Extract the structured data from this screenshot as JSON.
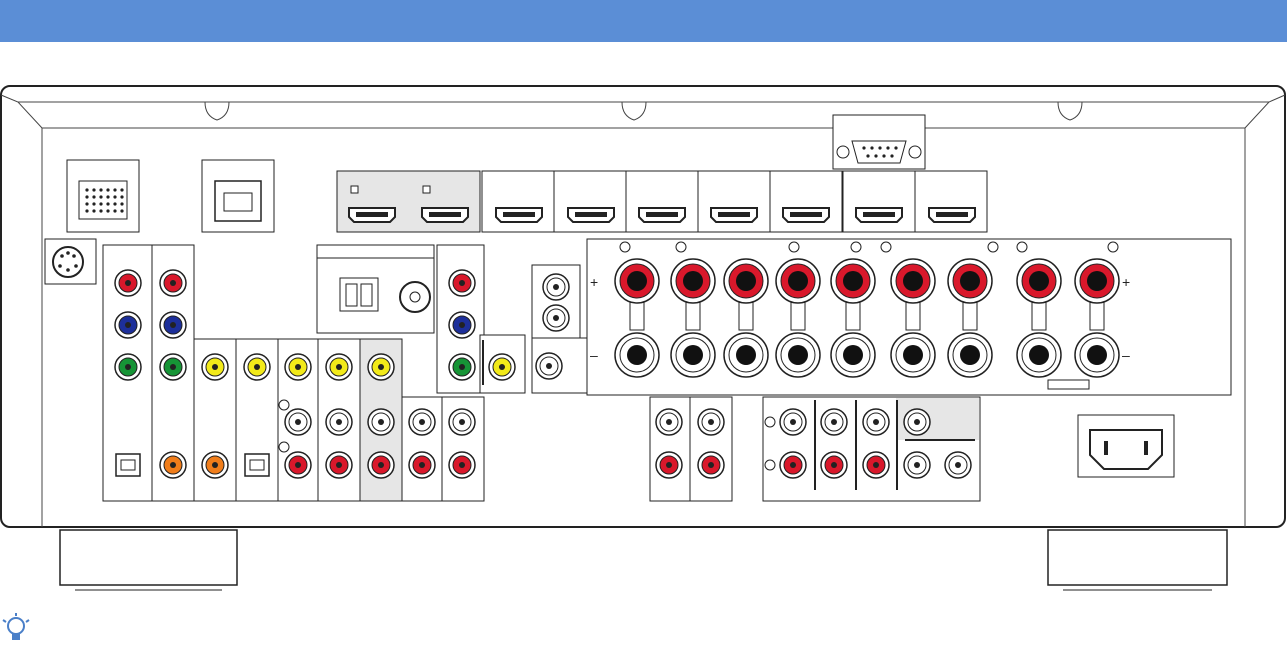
{
  "header": {
    "title": ""
  },
  "speaker_terminals": {
    "plus_sign": "+",
    "minus_sign": "–"
  },
  "tip": {
    "icon": "lightbulb-icon"
  },
  "colors": {
    "header": "#5b8ed6",
    "red": "#d9182b",
    "blue": "#1d2f9a",
    "green": "#169436",
    "yellow": "#f2ea19",
    "orange": "#f07d1a",
    "gray_panel": "#e6e6e6"
  }
}
